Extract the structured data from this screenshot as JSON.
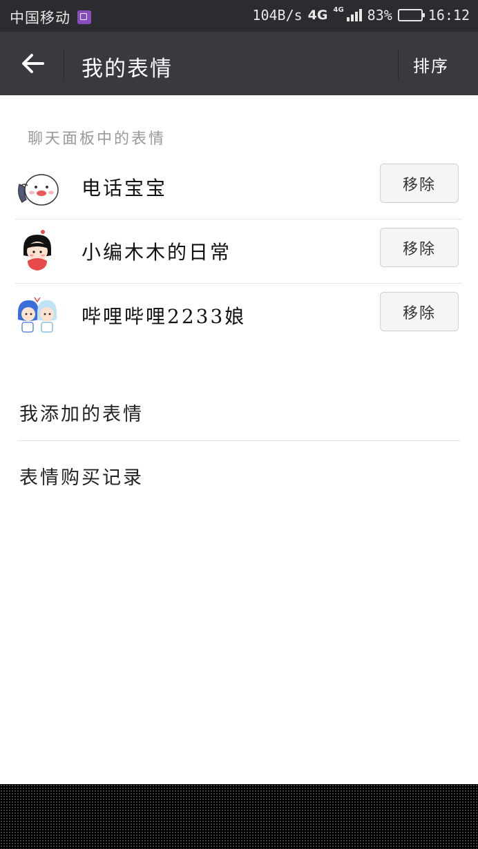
{
  "status_bar": {
    "carrier": "中国移动",
    "net_speed": "104B/s",
    "network_type": "4G",
    "signal_label": "4G",
    "battery": "83%",
    "time": "16:12"
  },
  "toolbar": {
    "title": "我的表情",
    "sort_label": "排序"
  },
  "chat_panel": {
    "header": "聊天面板中的表情",
    "packs": [
      {
        "name": "电话宝宝",
        "action": "移除"
      },
      {
        "name": "小编木木的日常",
        "action": "移除"
      },
      {
        "name": "哔哩哔哩2233娘",
        "action": "移除"
      }
    ]
  },
  "menu": {
    "added": "我添加的表情",
    "purchases": "表情购买记录"
  },
  "icons": {
    "back": "arrow-left-icon",
    "gallery": "gallery-notification-icon",
    "battery": "battery-icon",
    "signal": "signal-bars-icon"
  },
  "colors": {
    "status_bar": "#2b2c30",
    "toolbar": "#393a3f",
    "background": "#ffffff",
    "divider": "#e3e3e3"
  }
}
